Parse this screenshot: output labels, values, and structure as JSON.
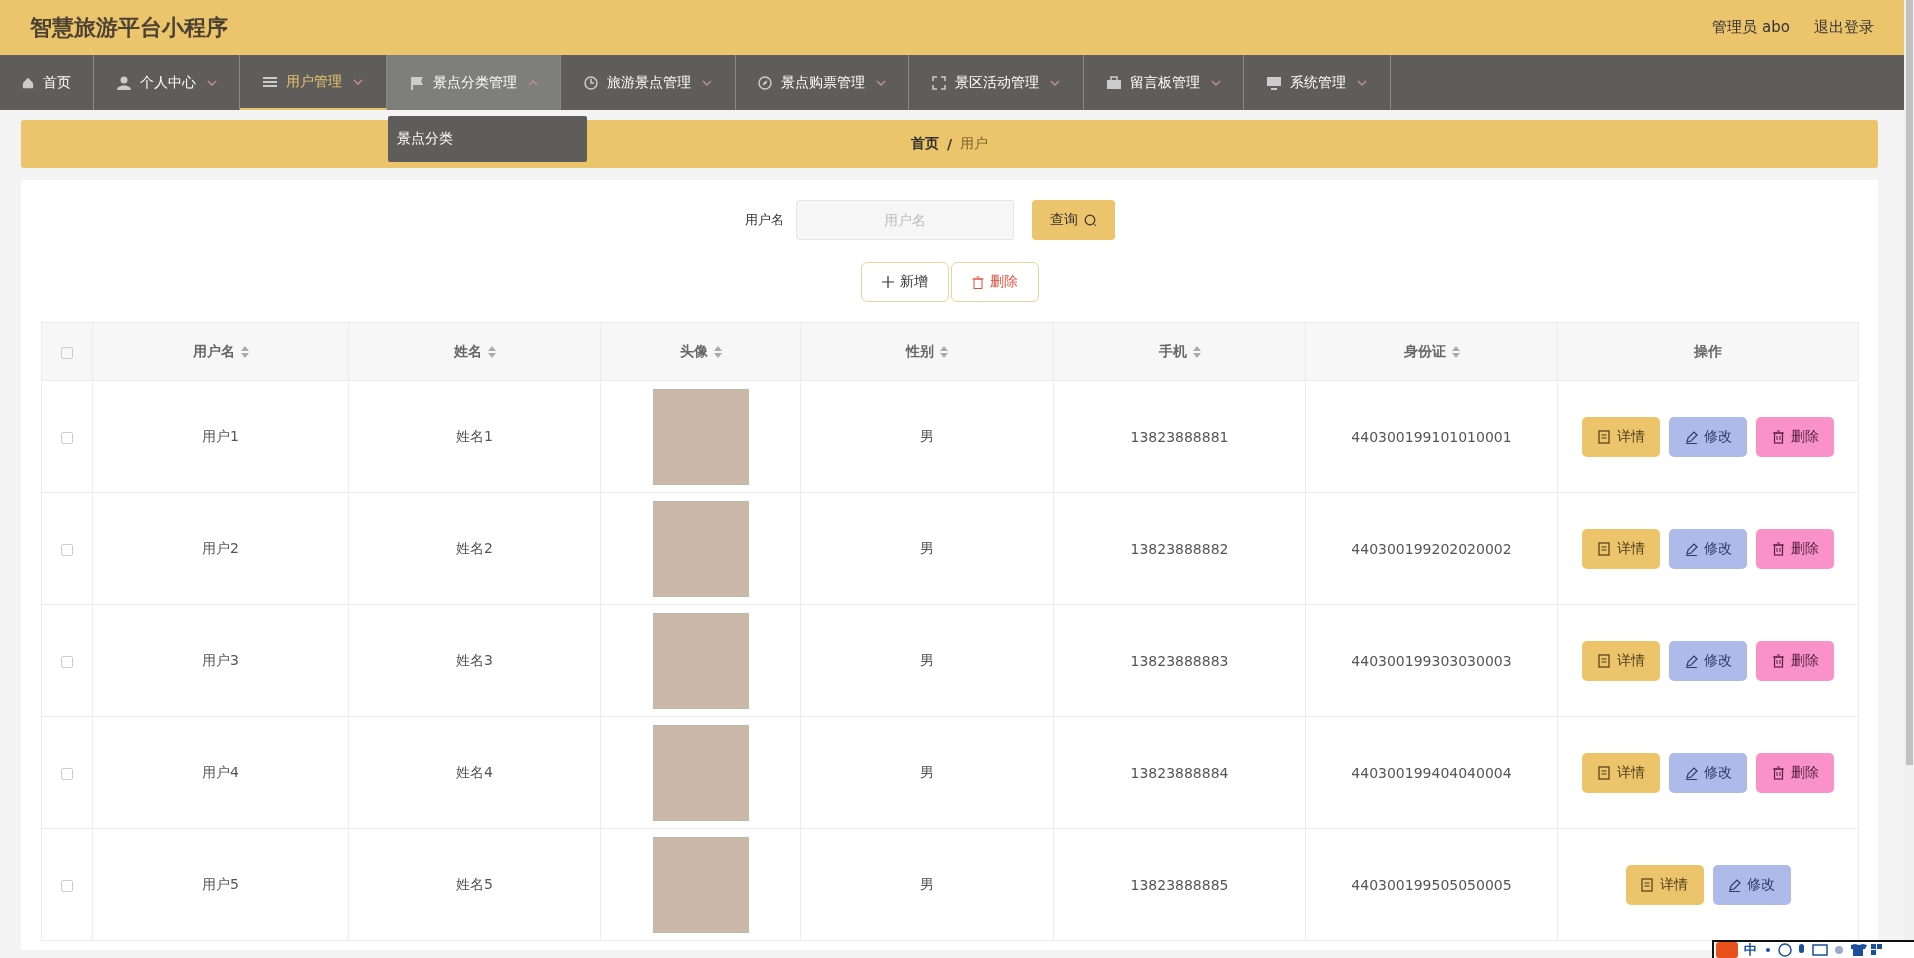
{
  "header": {
    "title": "智慧旅游平台小程序",
    "user": "管理员 abo",
    "logout": "退出登录"
  },
  "nav": [
    {
      "label": "首页",
      "selected": false,
      "expanded": false,
      "has_caret": false
    },
    {
      "label": "个人中心",
      "selected": false,
      "expanded": false,
      "has_caret": true
    },
    {
      "label": "用户管理",
      "selected": true,
      "expanded": false,
      "has_caret": true
    },
    {
      "label": "景点分类管理",
      "selected": false,
      "expanded": true,
      "has_caret": true,
      "submenu": [
        "景点分类"
      ]
    },
    {
      "label": "旅游景点管理",
      "selected": false,
      "expanded": false,
      "has_caret": true
    },
    {
      "label": "景点购票管理",
      "selected": false,
      "expanded": false,
      "has_caret": true
    },
    {
      "label": "景区活动管理",
      "selected": false,
      "expanded": false,
      "has_caret": true
    },
    {
      "label": "留言板管理",
      "selected": false,
      "expanded": false,
      "has_caret": true
    },
    {
      "label": "系统管理",
      "selected": false,
      "expanded": false,
      "has_caret": true
    }
  ],
  "breadcrumb": [
    "首页",
    "用户"
  ],
  "breadcrumb_separator": "/",
  "search": {
    "label": "用户名",
    "placeholder": "用户名",
    "button": "查询"
  },
  "toolbar": [
    {
      "kind": "add",
      "label": "新增"
    },
    {
      "kind": "delete",
      "label": "删除"
    }
  ],
  "table": {
    "columns": [
      {
        "label": "用户名",
        "sortable": true
      },
      {
        "label": "姓名",
        "sortable": true
      },
      {
        "label": "头像",
        "sortable": true
      },
      {
        "label": "性别",
        "sortable": true
      },
      {
        "label": "手机",
        "sortable": true
      },
      {
        "label": "身份证",
        "sortable": true
      },
      {
        "label": "操作",
        "sortable": false
      }
    ],
    "header_checked": false,
    "rows": [
      {
        "checked": false,
        "cells": [
          "用户1",
          "姓名1",
          "",
          "男",
          "13823888881",
          "440300199101010001"
        ],
        "actions": [
          {
            "kind": "detail",
            "label": "详情"
          },
          {
            "kind": "edit",
            "label": "修改"
          },
          {
            "kind": "delete",
            "label": "删除"
          }
        ]
      },
      {
        "checked": false,
        "cells": [
          "用户2",
          "姓名2",
          "",
          "男",
          "13823888882",
          "440300199202020002"
        ],
        "actions": [
          {
            "kind": "detail",
            "label": "详情"
          },
          {
            "kind": "edit",
            "label": "修改"
          },
          {
            "kind": "delete",
            "label": "删除"
          }
        ]
      },
      {
        "checked": false,
        "cells": [
          "用户3",
          "姓名3",
          "",
          "男",
          "13823888883",
          "440300199303030003"
        ],
        "actions": [
          {
            "kind": "detail",
            "label": "详情"
          },
          {
            "kind": "edit",
            "label": "修改"
          },
          {
            "kind": "delete",
            "label": "删除"
          }
        ]
      },
      {
        "checked": false,
        "cells": [
          "用户4",
          "姓名4",
          "",
          "男",
          "13823888884",
          "440300199404040004"
        ],
        "actions": [
          {
            "kind": "detail",
            "label": "详情"
          },
          {
            "kind": "edit",
            "label": "修改"
          },
          {
            "kind": "delete",
            "label": "删除"
          }
        ]
      },
      {
        "checked": false,
        "cells": [
          "用户5",
          "姓名5",
          "",
          "男",
          "13823888885",
          "440300199505050005"
        ],
        "actions": [
          {
            "kind": "detail",
            "label": "详情"
          },
          {
            "kind": "edit",
            "label": "修改"
          }
        ]
      }
    ]
  },
  "ime_toolbar": {
    "label": "中"
  }
}
